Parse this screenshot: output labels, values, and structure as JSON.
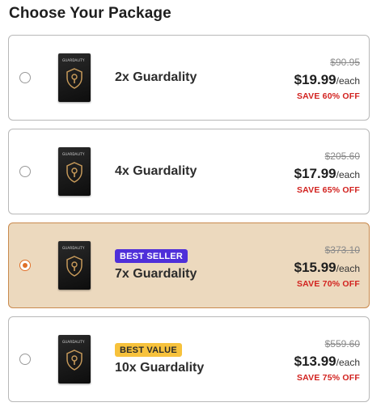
{
  "heading": "Choose Your Package",
  "colors": {
    "accent": "#e0702a",
    "save_red": "#d2221f",
    "selected_bg": "#ecd9be",
    "best_seller": "#4f2fd9",
    "best_value": "#f7c23c"
  },
  "product_image": {
    "icon": "shield-keyhole-icon",
    "brand_text": "GUARDALITY"
  },
  "packages": [
    {
      "name": "2x Guardality",
      "old_price": "$90.95",
      "price": "$19.99",
      "per": "/each",
      "save": "SAVE 60% OFF",
      "badge": "",
      "selected": false
    },
    {
      "name": "4x Guardality",
      "old_price": "$205.60",
      "price": "$17.99",
      "per": "/each",
      "save": "SAVE 65% OFF",
      "badge": "",
      "selected": false
    },
    {
      "name": "7x Guardality",
      "old_price": "$373.10",
      "price": "$15.99",
      "per": "/each",
      "save": "SAVE 70% OFF",
      "badge": "BEST SELLER",
      "selected": true
    },
    {
      "name": "10x Guardality",
      "old_price": "$559.60",
      "price": "$13.99",
      "per": "/each",
      "save": "SAVE 75% OFF",
      "badge": "BEST VALUE",
      "selected": false
    }
  ]
}
